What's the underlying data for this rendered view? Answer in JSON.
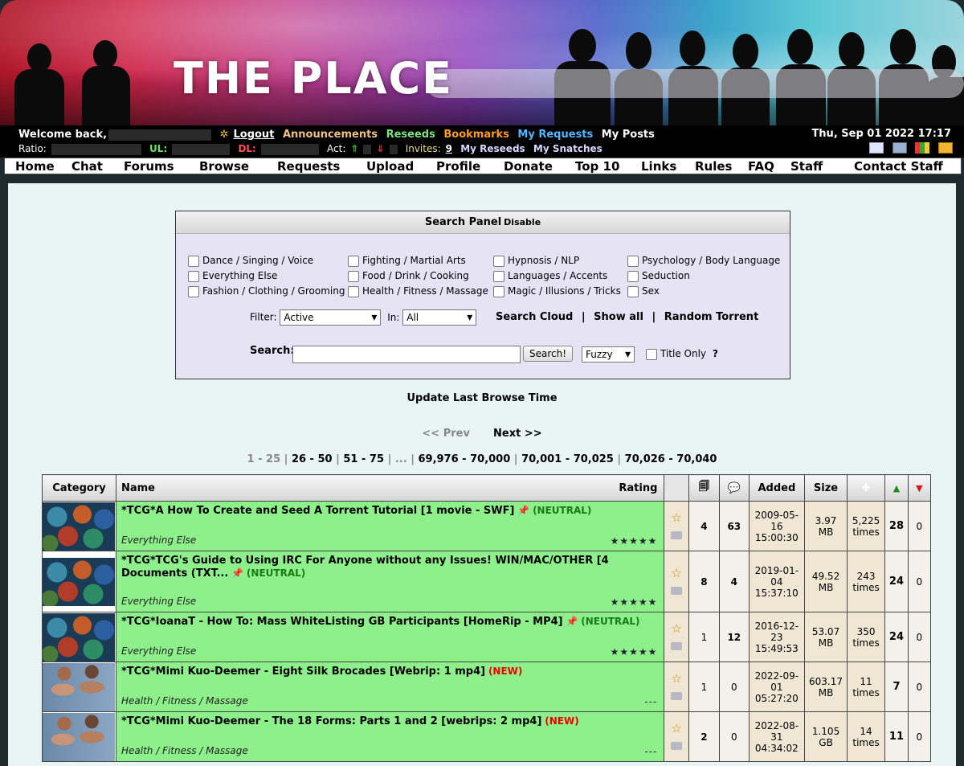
{
  "site": {
    "title": "THE PLACE"
  },
  "userbar": {
    "welcome": "Welcome back,",
    "logout": "Logout",
    "links": [
      {
        "label": "Announcements",
        "color": "#f0c080"
      },
      {
        "label": "Reseeds",
        "color": "#7ee07e"
      },
      {
        "label": "Bookmarks",
        "color": "#ff9a1a"
      },
      {
        "label": "My Requests",
        "color": "#4fb8ff"
      },
      {
        "label": "My Posts",
        "color": "#ffffff"
      }
    ],
    "ratio_label": "Ratio:",
    "ul_label": "UL:",
    "dl_label": "DL:",
    "act_label": "Act:",
    "invites_label": "Invites:",
    "invites_count": "9",
    "reseeds_link": "My Reseeds",
    "snatches_link": "My Snatches",
    "datetime": "Thu, Sep 01 2022 17:17"
  },
  "nav": [
    "Home",
    "Chat",
    "Forums",
    "Browse",
    "Requests",
    "Upload",
    "Profile",
    "Donate",
    "Top 10",
    "Links",
    "Rules",
    "FAQ",
    "Staff",
    "Contact Staff"
  ],
  "search_panel": {
    "title": "Search Panel",
    "disable": "Disable",
    "categories": [
      [
        "Dance / Singing / Voice",
        "Everything Else",
        "Fashion / Clothing / Grooming"
      ],
      [
        "Fighting / Martial Arts",
        "Food / Drink / Cooking",
        "Health / Fitness / Massage"
      ],
      [
        "Hypnosis / NLP",
        "Languages / Accents",
        "Magic / Illusions / Tricks"
      ],
      [
        "Psychology / Body Language",
        "Seduction",
        "Sex"
      ]
    ],
    "filter_label": "Filter:",
    "filter_value": "Active",
    "in_label": "In:",
    "in_value": "All",
    "search_cloud": "Search Cloud",
    "show_all": "Show all",
    "random_torrent": "Random Torrent",
    "search_label": "Search:",
    "search_value": "",
    "search_button": "Search!",
    "mode_value": "Fuzzy",
    "title_only": "Title Only",
    "help": "?"
  },
  "update_link": "Update Last Browse Time",
  "pager": {
    "prev": "<< Prev",
    "next": "Next >>",
    "current": "1 - 25",
    "pages": [
      "26 - 50",
      "51 - 75",
      "...",
      "69,976 - 70,000",
      "70,001 - 70,025",
      "70,026 - 70,040"
    ]
  },
  "table": {
    "headers": {
      "category": "Category",
      "name": "Name",
      "rating": "Rating",
      "added": "Added",
      "size": "Size"
    },
    "rows": [
      {
        "name": "*TCG*A How To Create and Seed A Torrent Tutorial [1 movie - SWF]",
        "tag": "(NEUTRAL)",
        "tag_type": "neutral",
        "category": "Everything Else",
        "rating": "★★★★★",
        "files": "4",
        "comments": "63",
        "added_date": "2009-05-16",
        "added_time": "15:00:30",
        "size_num": "3.97",
        "size_unit": "MB",
        "snatched_num": "5,225",
        "snatched_unit": "times",
        "seeders": "28",
        "leechers": "0",
        "thumb": "eggs"
      },
      {
        "name": "*TCG*TCG's Guide to Using IRC For Anyone without any Issues! WIN/MAC/OTHER [4 Documents (TXT...",
        "tag": "(NEUTRAL)",
        "tag_type": "neutral",
        "category": "Everything Else",
        "rating": "★★★★★",
        "files": "8",
        "comments": "4",
        "added_date": "2019-01-04",
        "added_time": "15:37:10",
        "size_num": "49.52",
        "size_unit": "MB",
        "snatched_num": "243",
        "snatched_unit": "times",
        "seeders": "24",
        "leechers": "0",
        "thumb": "eggs"
      },
      {
        "name": "*TCG*IoanaT - How To: Mass WhiteListing GB Participants [HomeRip - MP4]",
        "tag": "(NEUTRAL)",
        "tag_type": "neutral",
        "category": "Everything Else",
        "rating": "★★★★★",
        "files": "1",
        "comments": "12",
        "added_date": "2016-12-23",
        "added_time": "15:49:53",
        "size_num": "53.07",
        "size_unit": "MB",
        "snatched_num": "350",
        "snatched_unit": "times",
        "seeders": "24",
        "leechers": "0",
        "thumb": "eggs"
      },
      {
        "name": "*TCG*Mimi Kuo-Deemer - Eight Silk Brocades [Webrip: 1 mp4]",
        "tag": "(NEW)",
        "tag_type": "new",
        "category": "Health / Fitness / Massage",
        "rating": "---",
        "files": "1",
        "comments": "0",
        "added_date": "2022-09-01",
        "added_time": "05:27:20",
        "size_num": "603.17",
        "size_unit": "MB",
        "snatched_num": "11",
        "snatched_unit": "times",
        "seeders": "7",
        "leechers": "0",
        "thumb": "fit"
      },
      {
        "name": "*TCG*Mimi Kuo-Deemer - The 18 Forms: Parts 1 and 2 [webrips: 2 mp4]",
        "tag": "(NEW)",
        "tag_type": "new",
        "category": "Health / Fitness / Massage",
        "rating": "---",
        "files": "2",
        "comments": "0",
        "added_date": "2022-08-31",
        "added_time": "04:34:02",
        "size_num": "1.105",
        "size_unit": "GB",
        "snatched_num": "14",
        "snatched_unit": "times",
        "seeders": "11",
        "leechers": "0",
        "thumb": "fit"
      }
    ]
  }
}
